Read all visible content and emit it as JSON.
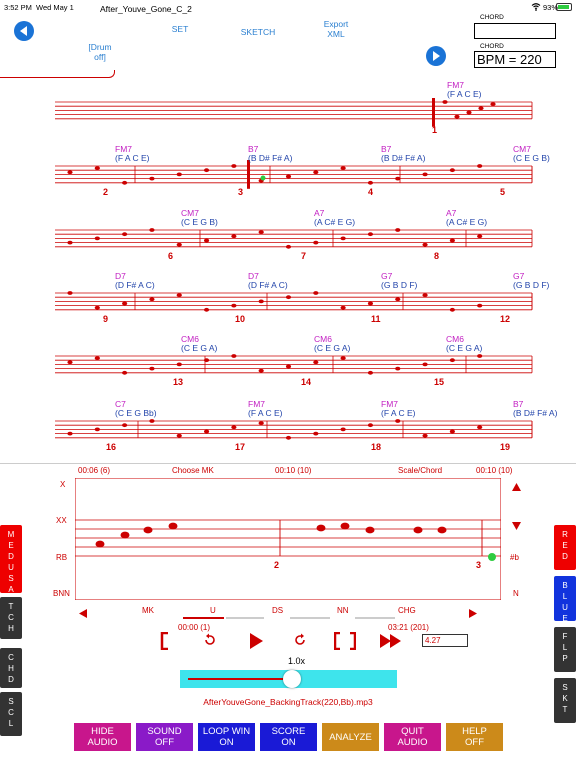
{
  "status_bar": {
    "time": "3:52 PM",
    "date": "Wed May 1",
    "battery": "93%"
  },
  "header": {
    "file_title": "After_Youve_Gone_C_2",
    "set_label": "SET",
    "sketch_label": "SKETCH",
    "export_label_1": "Export",
    "export_label_2": "XML",
    "drum_label_1": "[Drum",
    "drum_label_2": "off]",
    "chord_label_1": "CHORD",
    "chord_label_2": "CHORD",
    "bpm_value": "BPM = 220"
  },
  "score": {
    "rows": [
      {
        "chords": [
          {
            "name": "FM7",
            "notes": "(F A C E)"
          }
        ]
      },
      {
        "chords": [
          {
            "name": "FM7",
            "notes": "(F A C E)"
          },
          {
            "name": "B7",
            "notes": "(B D# F# A)"
          },
          {
            "name": "B7",
            "notes": "(B D# F# A)"
          },
          {
            "name": "CM7",
            "notes": "(C E G B)"
          }
        ],
        "measures": [
          "2",
          "3",
          "4",
          "5"
        ]
      },
      {
        "chords": [
          {
            "name": "CM7",
            "notes": "(C E G B)"
          },
          {
            "name": "A7",
            "notes": "(A C# E G)"
          },
          {
            "name": "A7",
            "notes": "(A C# E G)"
          }
        ],
        "measures": [
          "6",
          "7",
          "8"
        ]
      },
      {
        "chords": [
          {
            "name": "D7",
            "notes": "(D F# A C)"
          },
          {
            "name": "D7",
            "notes": "(D F# A C)"
          },
          {
            "name": "G7",
            "notes": "(G B D F)"
          },
          {
            "name": "G7",
            "notes": "(G B D F)"
          }
        ],
        "measures": [
          "9",
          "10",
          "11",
          "12"
        ]
      },
      {
        "chords": [
          {
            "name": "CM6",
            "notes": "(C E G A)"
          },
          {
            "name": "CM6",
            "notes": "(C E G A)"
          },
          {
            "name": "CM6",
            "notes": "(C E G A)"
          }
        ],
        "measures": [
          "13",
          "14",
          "15"
        ]
      },
      {
        "chords": [
          {
            "name": "C7",
            "notes": "(C E G Bb)"
          },
          {
            "name": "FM7",
            "notes": "(F A C E)"
          },
          {
            "name": "FM7",
            "notes": "(F A C E)"
          },
          {
            "name": "B7",
            "notes": "(B D# F# A)"
          }
        ],
        "measures": [
          "16",
          "17",
          "18",
          "19"
        ]
      }
    ],
    "first_measure": "1"
  },
  "panel": {
    "time_left": "00:06 (6)",
    "choose_mk": "Choose MK",
    "time_mid": "00:10 (10)",
    "scale_chord": "Scale/Chord",
    "time_right": "00:10 (10)",
    "row_labels": [
      "X",
      "XX",
      "RB",
      "BNN"
    ],
    "right_labels": [
      "#b",
      "N"
    ],
    "zoom_measures": [
      "2",
      "3"
    ],
    "tick_labels": [
      "MK",
      "U",
      "DS",
      "NN",
      "CHG"
    ],
    "pos_time": "00:00 (1)",
    "total_time": "03:21 (201)",
    "value_field": "4.27",
    "speed_label": "1.0x",
    "speed_fraction": 0.52,
    "track_name": "AfterYouveGone_BackingTrack(220,Bb).mp3"
  },
  "left_buttons": [
    {
      "letters": [
        "M",
        "E",
        "D",
        "U",
        "S",
        "A"
      ],
      "color": "#ee0000"
    },
    {
      "letters": [
        "T",
        "C",
        "H"
      ],
      "color": "#333333"
    },
    {
      "letters": [
        "C",
        "H",
        "D"
      ],
      "color": "#333333"
    },
    {
      "letters": [
        "S",
        "C",
        "L"
      ],
      "color": "#333333"
    }
  ],
  "right_buttons": [
    {
      "letters": [
        "R",
        "E",
        "D"
      ],
      "color": "#ee0000"
    },
    {
      "letters": [
        "B",
        "L",
        "U",
        "E"
      ],
      "color": "#1133dd"
    },
    {
      "letters": [
        "F",
        "L",
        "P"
      ],
      "color": "#333333"
    },
    {
      "letters": [
        "S",
        "K",
        "T"
      ],
      "color": "#333333"
    }
  ],
  "bottom_buttons": [
    {
      "line1": "HIDE",
      "line2": "AUDIO",
      "color": "#c8168c"
    },
    {
      "line1": "SOUND",
      "line2": "OFF",
      "color": "#8a1ac8"
    },
    {
      "line1": "LOOP WIN",
      "line2": "ON",
      "color": "#1a1ad6"
    },
    {
      "line1": "SCORE",
      "line2": "ON",
      "color": "#1a1ad6"
    },
    {
      "line1": "ANALYZE",
      "line2": "",
      "color": "#cc8a1a"
    },
    {
      "line1": "QUIT",
      "line2": "AUDIO",
      "color": "#c8168c"
    },
    {
      "line1": "HELP",
      "line2": "OFF",
      "color": "#cc8a1a"
    }
  ],
  "colors": {
    "staff_red": "#cc0000",
    "chord_magenta": "#c21fc2",
    "chord_blue": "#2244aa",
    "accent_blue": "#1a73d6"
  }
}
